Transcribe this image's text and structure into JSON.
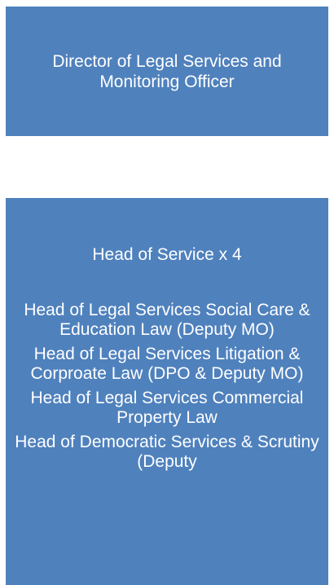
{
  "diagram": {
    "top_box": {
      "title": "Director of Legal Services and Monitoring Officer"
    },
    "bottom_box": {
      "heading": "Head of Service x 4",
      "roles": [
        "Head of Legal Services Social Care & Education Law (Deputy MO)",
        "Head of Legal Services Litigation & Corproate Law (DPO & Deputy MO)",
        "Head of Legal Services Commercial Property Law",
        "Head of Democratic Services & Scrutiny (Deputy"
      ]
    },
    "colors": {
      "box_fill": "#4f81bd",
      "text": "#ffffff",
      "background": "#ffffff"
    }
  }
}
